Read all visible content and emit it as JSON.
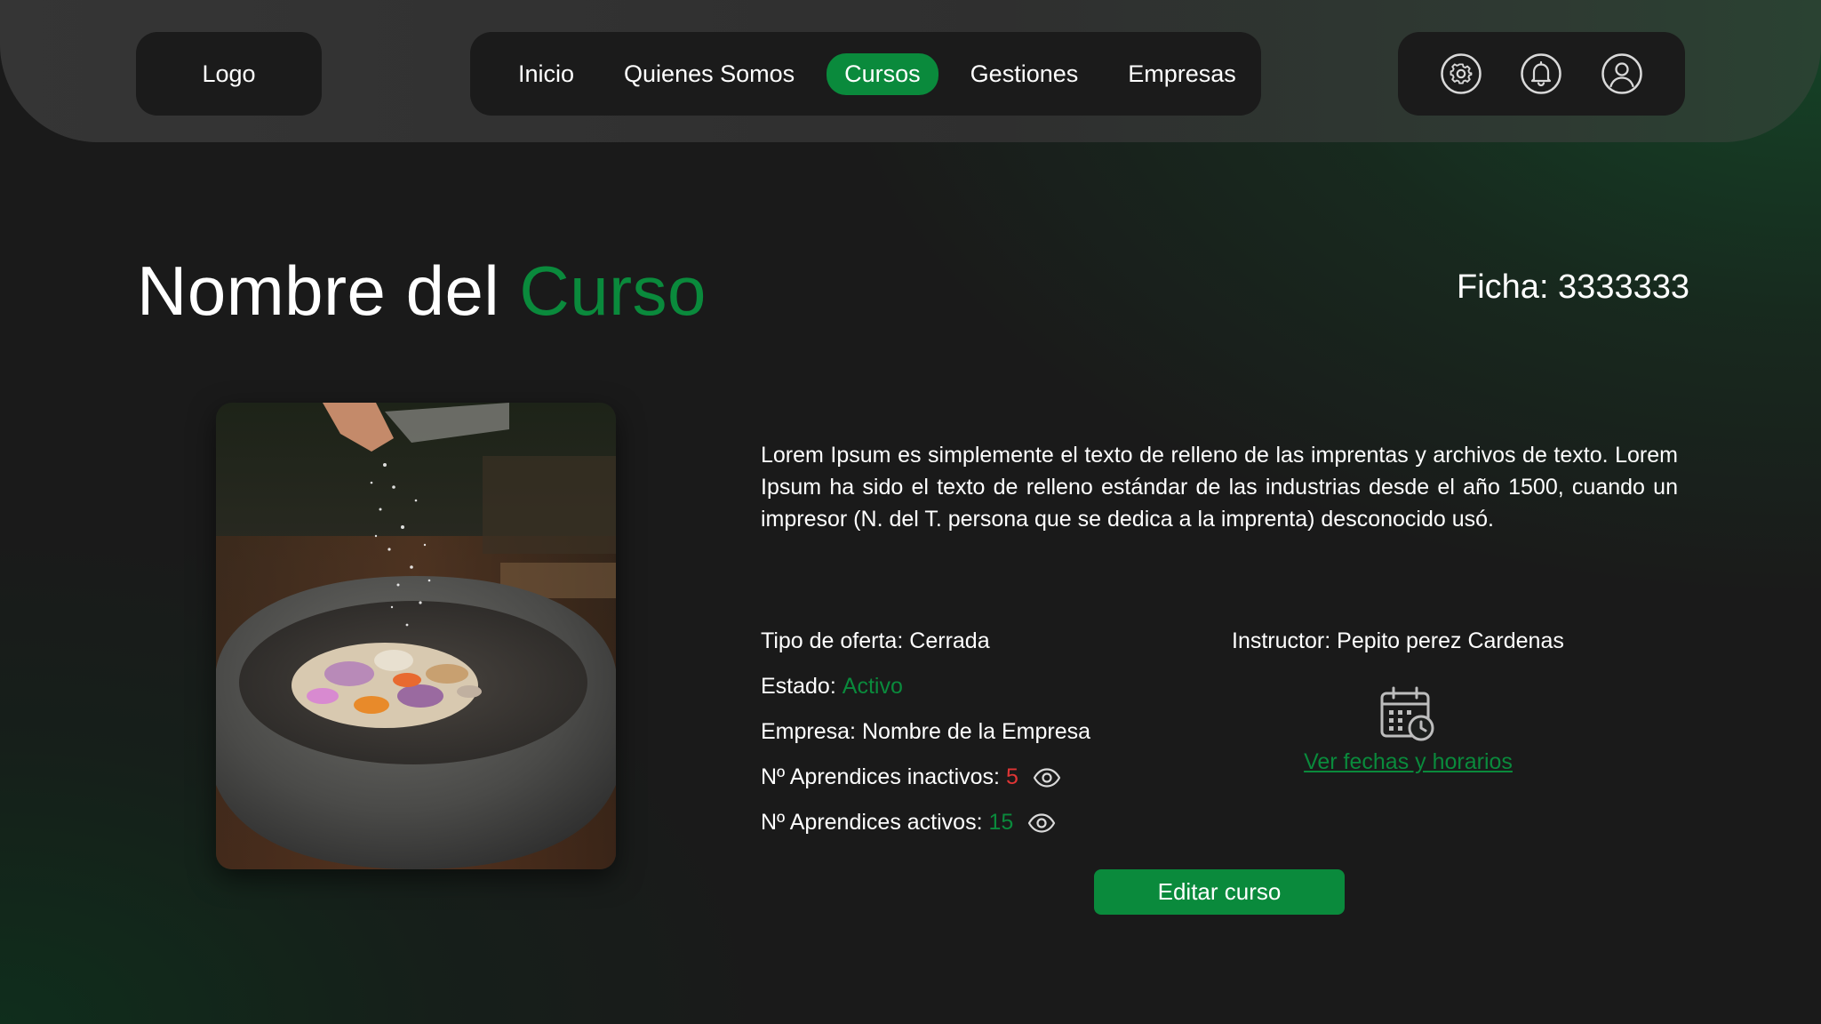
{
  "header": {
    "logo_text": "Logo",
    "nav": [
      {
        "label": "Inicio",
        "active": false
      },
      {
        "label": "Quienes Somos",
        "active": false
      },
      {
        "label": "Cursos",
        "active": true
      },
      {
        "label": "Gestiones",
        "active": false
      },
      {
        "label": "Empresas",
        "active": false
      }
    ],
    "icons": [
      "settings-icon",
      "bell-icon",
      "user-icon"
    ]
  },
  "course": {
    "title_main": "Nombre del",
    "title_accent": "Curso",
    "ficha": "Ficha: 3333333",
    "description": "Lorem Ipsum es simplemente el texto de relleno de las imprentas y archivos de texto. Lorem Ipsum ha sido el texto de relleno estándar de las industrias desde el año 1500, cuando un impresor (N. del T. persona que se dedica a la imprenta) desconocido usó.",
    "offer_type_label": "Tipo de oferta:",
    "offer_type_value": "Cerrada",
    "status_label": "Estado:",
    "status_value": "Activo",
    "company_label": "Empresa:",
    "company_value": "Nombre de la Empresa",
    "inactive_label": "Nº Aprendices inactivos:",
    "inactive_count": "5",
    "active_label": "Nº Aprendices activos:",
    "active_count": "15",
    "instructor_label": "Instructor:",
    "instructor_value": "Pepito perez Cardenas",
    "schedule_link": "Ver fechas y horarios",
    "edit_button": "Editar curso"
  },
  "colors": {
    "accent": "#0a8a3c",
    "danger": "#e03535",
    "background": "#1a1a1a",
    "panel": "#1b1b1b"
  }
}
